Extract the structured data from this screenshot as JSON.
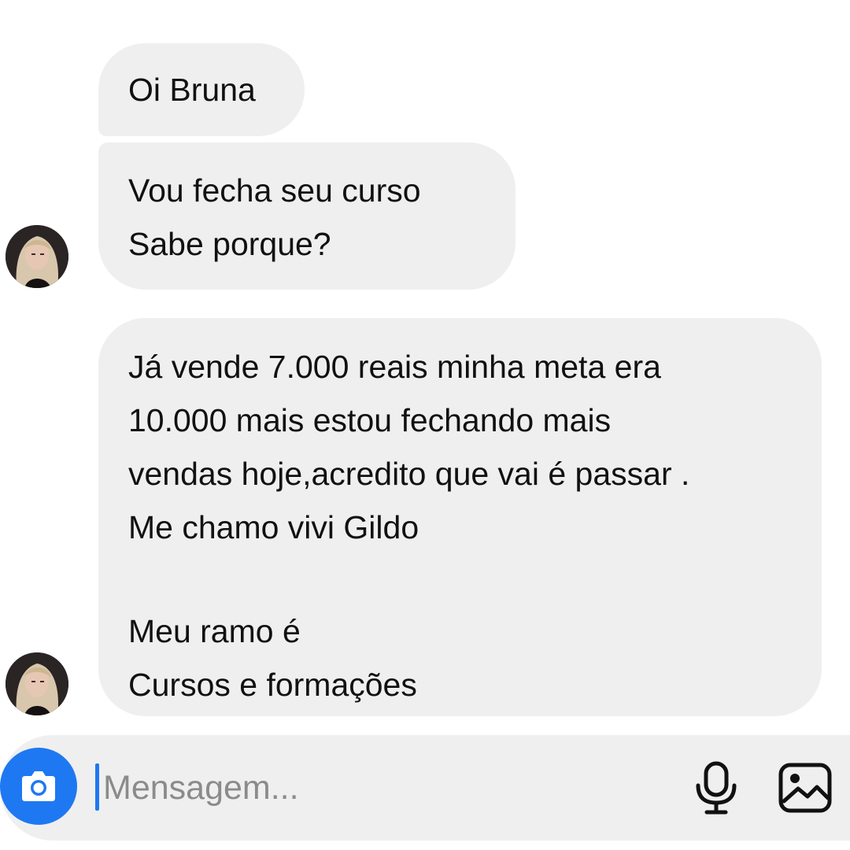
{
  "messages": [
    {
      "lines": [
        "Oi Bruna"
      ]
    },
    {
      "lines": [
        "Vou fecha seu curso",
        "Sabe porque?"
      ]
    },
    {
      "lines": [
        "Já vende 7.000 reais minha meta era",
        "10.000 mais estou fechando mais",
        "vendas hoje,acredito que vai é passar .",
        "Me chamo vivi Gildo",
        "",
        "Meu ramo é",
        "Cursos e formações"
      ]
    }
  ],
  "composer": {
    "placeholder": "Mensagem...",
    "icons": [
      "camera-icon",
      "microphone-icon",
      "image-icon"
    ]
  },
  "colors": {
    "bubble": "#efefef",
    "accent": "#1e78f2",
    "text": "#111111",
    "placeholder": "#8b8b8b"
  }
}
